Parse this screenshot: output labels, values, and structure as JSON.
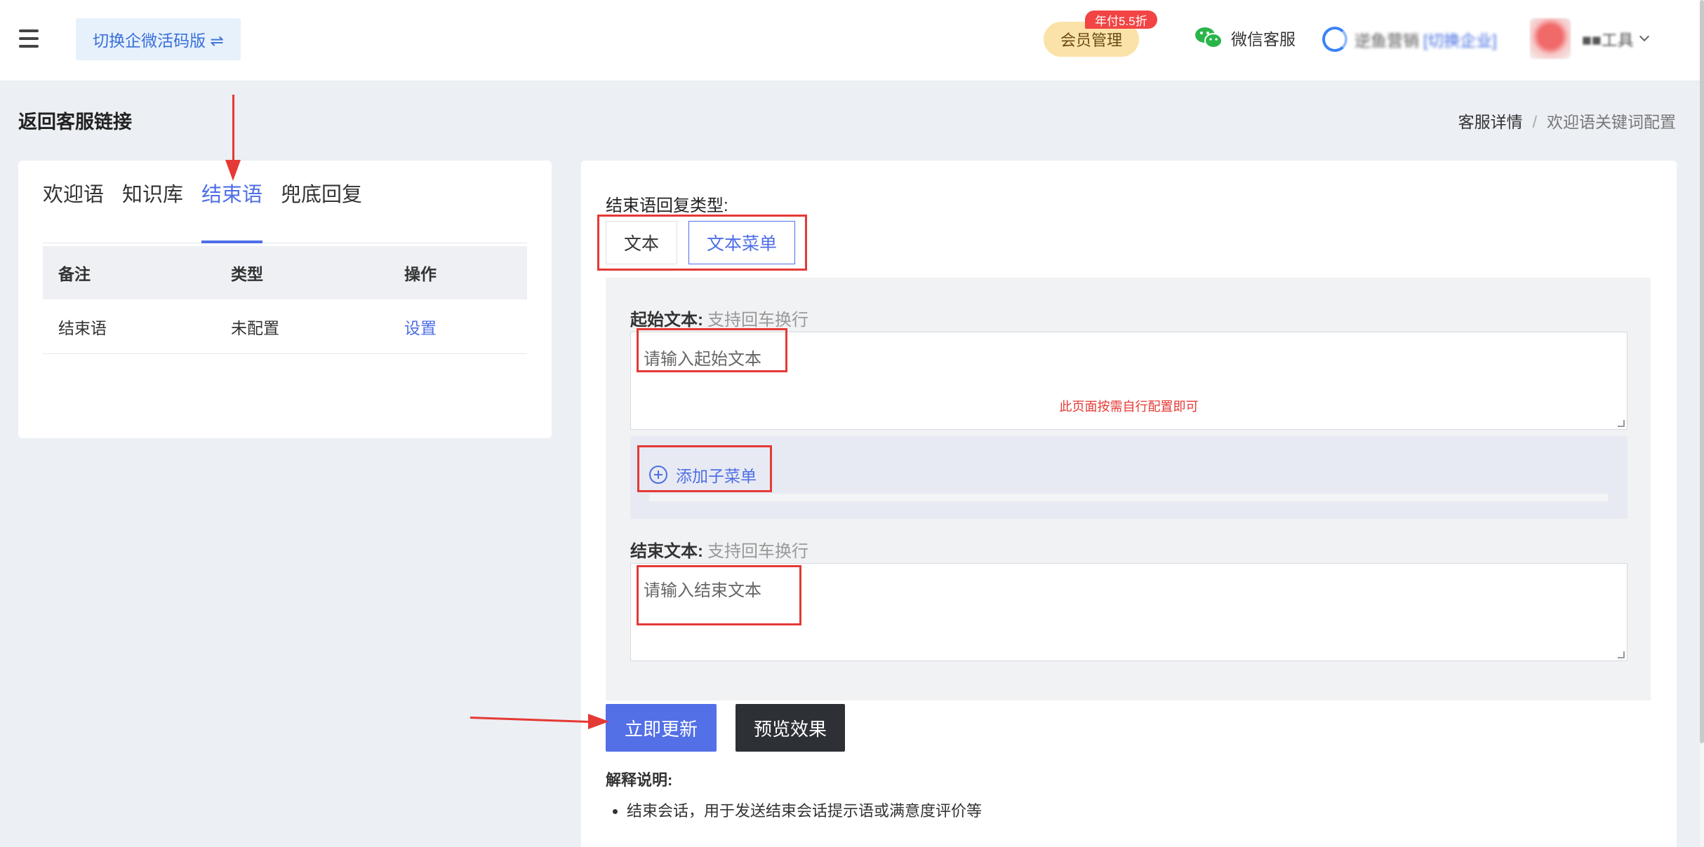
{
  "header": {
    "switch_label": "切换企微活码版 ⇌",
    "member_label": "会员管理",
    "member_badge": "年付5.5折",
    "wechat_label": "微信客服",
    "company_prefix": "逆鱼营销",
    "company_switch": "[切换企业]",
    "user_name": "■■工具"
  },
  "page": {
    "title": "返回客服链接",
    "breadcrumb": [
      "客服详情",
      "欢迎语关键词配置"
    ]
  },
  "left": {
    "tabs": [
      "欢迎语",
      "知识库",
      "结束语",
      "兜底回复"
    ],
    "active_tab": "结束语",
    "table": {
      "headers": [
        "备注",
        "类型",
        "操作"
      ],
      "rows": [
        {
          "note": "结束语",
          "type": "未配置",
          "action": "设置"
        }
      ]
    }
  },
  "right": {
    "type_label": "结束语回复类型:",
    "type_options": [
      "文本",
      "文本菜单"
    ],
    "selected_type": "文本菜单",
    "start_label": "起始文本:",
    "start_hint": "支持回车换行",
    "start_placeholder": "请输入起始文本",
    "note_red": "此页面按需自行配置即可",
    "add_submenu": "添加子菜单",
    "end_label": "结束文本:",
    "end_hint": "支持回车换行",
    "end_placeholder": "请输入结束文本",
    "update_btn": "立即更新",
    "preview_btn": "预览效果",
    "explain_title": "解释说明:",
    "explain_items": [
      "结束会话，用于发送结束会话提示语或满意度评价等"
    ]
  },
  "colors": {
    "accent": "#4f6ee6",
    "annotation": "#e53935",
    "dark_button": "#2d3136"
  }
}
